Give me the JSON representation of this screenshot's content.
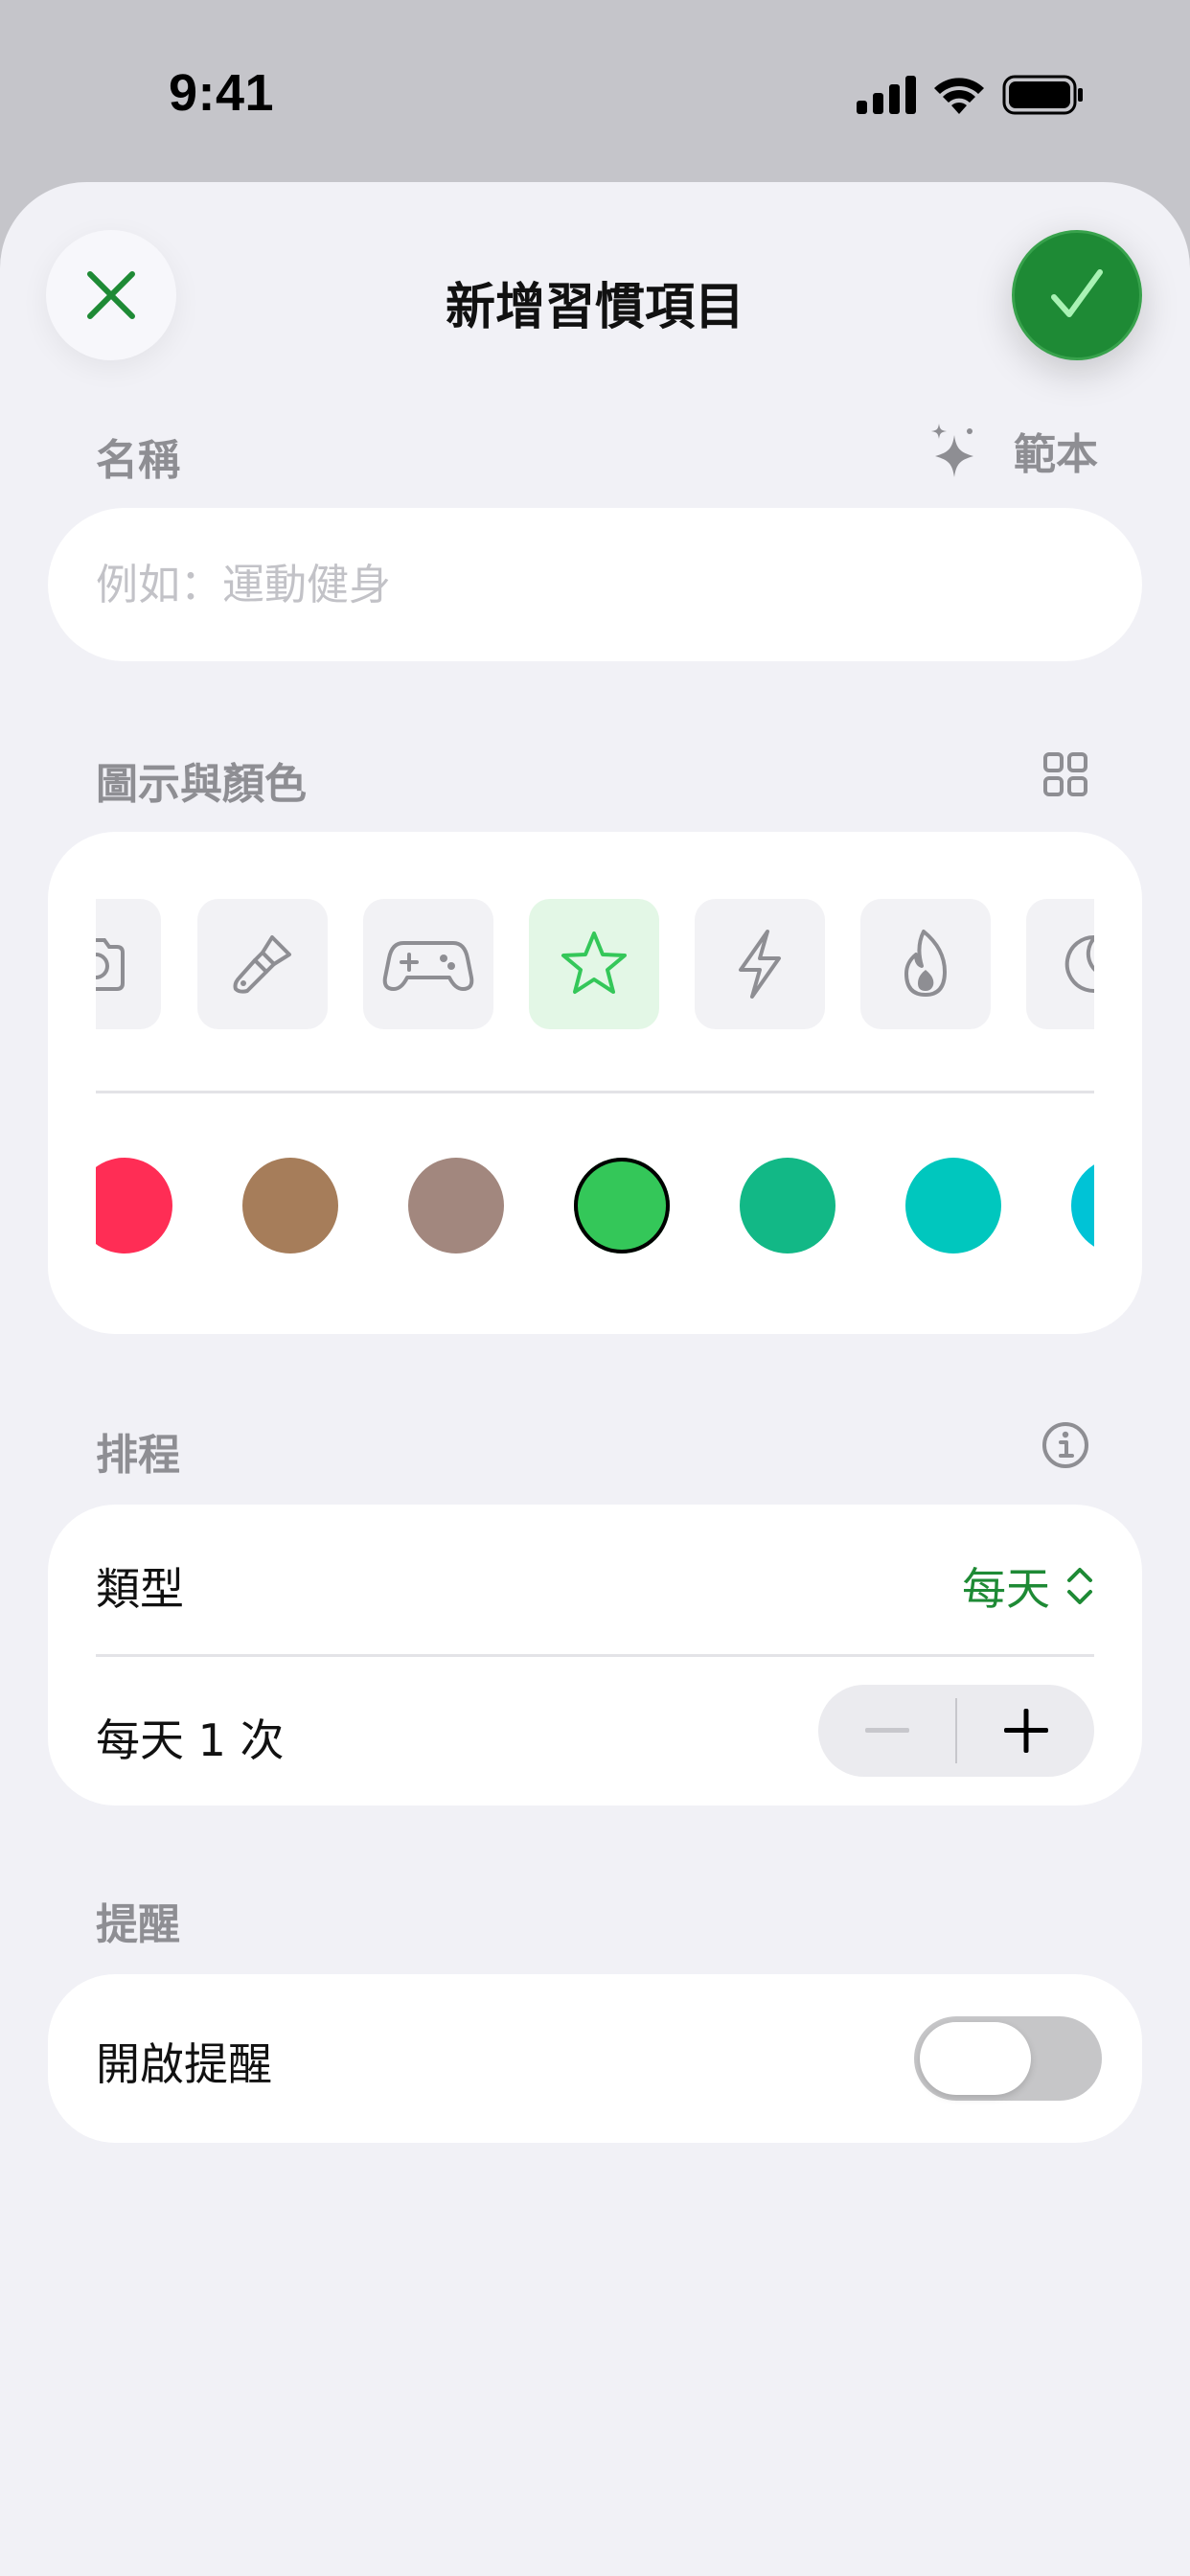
{
  "status_bar": {
    "time": "9:41",
    "icons": [
      "cellular-signal-icon",
      "wifi-icon",
      "battery-icon"
    ]
  },
  "header": {
    "title": "新增習慣項目",
    "close_icon": "close-icon",
    "confirm_icon": "checkmark-icon"
  },
  "name_section": {
    "label": "名稱",
    "template_label": "範本",
    "template_icon": "sparkles-icon",
    "input_placeholder": "例如：運動健身",
    "input_value": ""
  },
  "icon_color_section": {
    "label": "圖示與顏色",
    "grid_icon": "grid-icon",
    "icons": [
      {
        "name": "camera-icon",
        "selected": false
      },
      {
        "name": "paintbrush-icon",
        "selected": false
      },
      {
        "name": "gamecontroller-icon",
        "selected": false
      },
      {
        "name": "star-icon",
        "selected": true
      },
      {
        "name": "bolt-icon",
        "selected": false
      },
      {
        "name": "flame-icon",
        "selected": false
      },
      {
        "name": "moon-icon",
        "selected": false
      }
    ],
    "colors": [
      {
        "hex": "#ff2d55",
        "selected": false
      },
      {
        "hex": "#a67d5a",
        "selected": false
      },
      {
        "hex": "#a2877e",
        "selected": false
      },
      {
        "hex": "#34c759",
        "selected": true
      },
      {
        "hex": "#12b886",
        "selected": false
      },
      {
        "hex": "#00c7be",
        "selected": false
      },
      {
        "hex": "#00c3d6",
        "selected": false
      }
    ]
  },
  "schedule_section": {
    "label": "排程",
    "info_icon": "info-icon",
    "type_label": "類型",
    "type_value": "每天",
    "frequency_label": "每天 1 次",
    "decrement_enabled": false
  },
  "reminder_section": {
    "label": "提醒",
    "toggle_label": "開啟提醒",
    "toggle_on": false
  },
  "colors": {
    "accent": "#1e8a35",
    "background": "#f1f1f6",
    "label_gray": "#8e8e93"
  }
}
